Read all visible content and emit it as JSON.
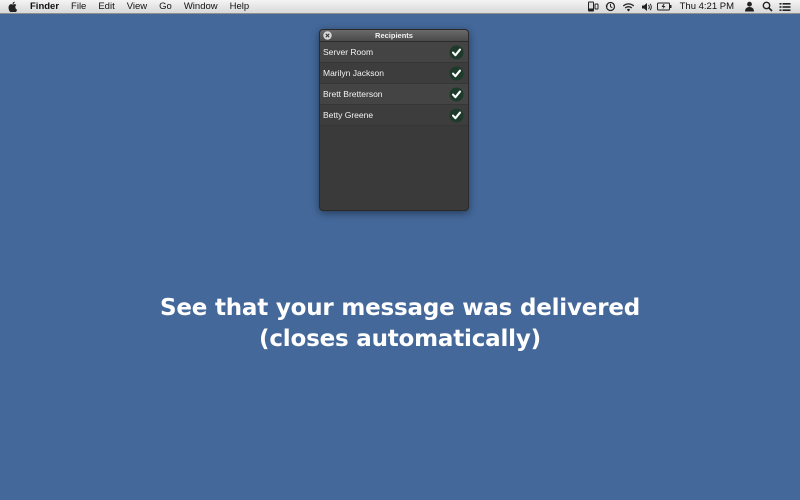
{
  "menubar": {
    "apple_icon": "apple-logo-icon",
    "app_name": "Finder",
    "items": [
      "File",
      "Edit",
      "View",
      "Go",
      "Window",
      "Help"
    ],
    "status_icons": [
      "sync-device-icon",
      "time-machine-icon",
      "wifi-icon",
      "volume-icon",
      "battery-icon"
    ],
    "clock": "Thu 4:21 PM",
    "user_icon": "user-icon",
    "spotlight_icon": "search-icon",
    "list_icon": "notification-list-icon"
  },
  "panel": {
    "title": "Recipients",
    "recipients": [
      {
        "name": "Server Room",
        "status": "delivered"
      },
      {
        "name": "Marilyn Jackson",
        "status": "delivered"
      },
      {
        "name": "Brett Bretterson",
        "status": "delivered"
      },
      {
        "name": "Betty Greene",
        "status": "delivered"
      }
    ]
  },
  "caption": {
    "line1": "See that your message was delivered",
    "line2": "(closes automatically)"
  },
  "colors": {
    "desktop": "#44689a",
    "panel_bg": "#3a3a3a",
    "check_bg": "#1e3a2a",
    "text_white": "#ffffff"
  }
}
